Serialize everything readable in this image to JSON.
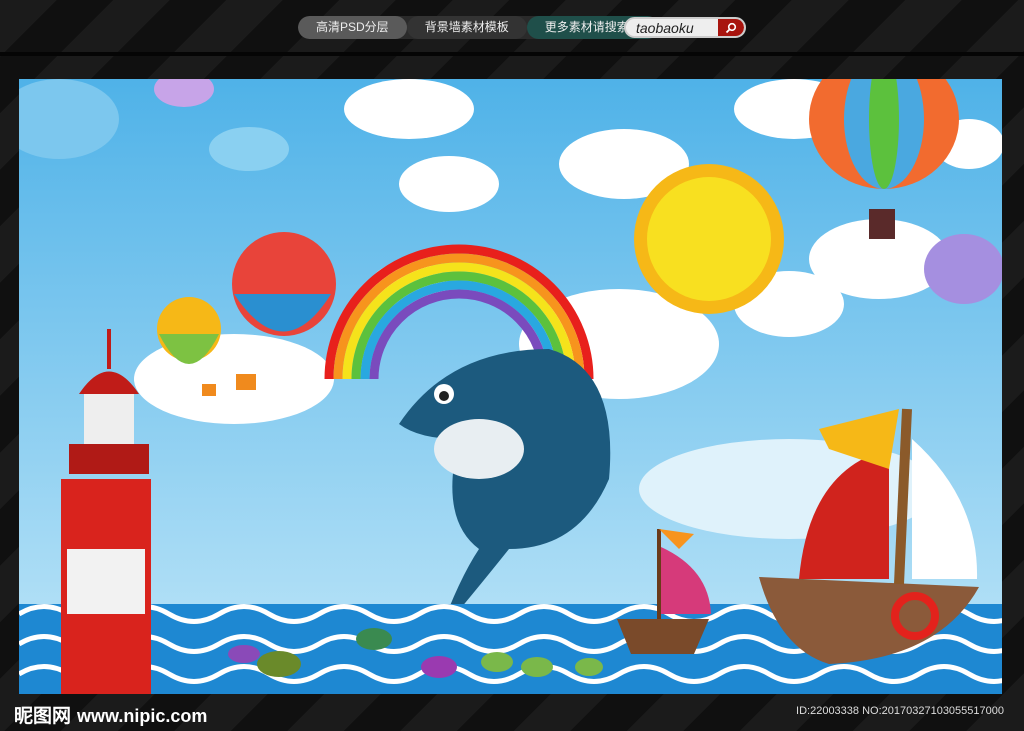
{
  "topbar": {
    "tabs": [
      "高清PSD分层",
      "背景墙素材模板",
      "更多素材请搜索"
    ],
    "search_value": "taobaoku"
  },
  "footer": {
    "logo_cn": "昵图网",
    "logo_url": "www.nipic.com",
    "id_text": "ID:22003338 NO:20170327103055517000"
  },
  "colors": {
    "sky": "#5bb8ea",
    "sea": "#1e88d2",
    "search_button": "#a8140e"
  }
}
